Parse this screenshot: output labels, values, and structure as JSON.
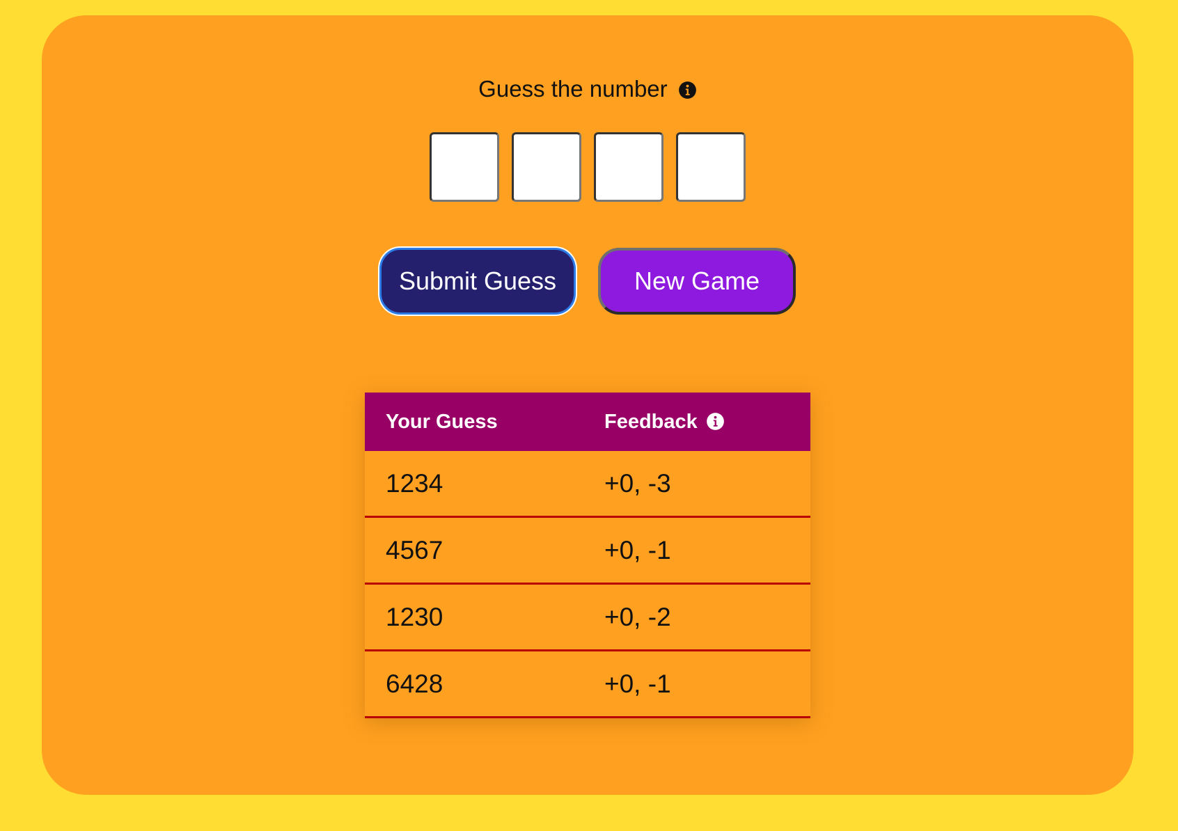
{
  "header": {
    "title": "Guess the number"
  },
  "inputs": {
    "digits": [
      "",
      "",
      "",
      ""
    ]
  },
  "buttons": {
    "submit_label": "Submit Guess",
    "new_game_label": "New Game"
  },
  "history": {
    "columns": [
      "Your Guess",
      "Feedback"
    ],
    "rows": [
      {
        "guess": "1234",
        "feedback": "+0, -3"
      },
      {
        "guess": "4567",
        "feedback": "+0, -1"
      },
      {
        "guess": "1230",
        "feedback": "+0, -2"
      },
      {
        "guess": "6428",
        "feedback": "+0, -1"
      }
    ]
  },
  "icons": {
    "title_info": "info-icon",
    "feedback_info": "info-icon"
  },
  "colors": {
    "page_background": "#FFDD33",
    "card_background": "#FFA020",
    "submit_button": "#25206E",
    "new_game_button": "#8E1ADF",
    "table_header": "#990066",
    "row_divider": "#B80000"
  }
}
